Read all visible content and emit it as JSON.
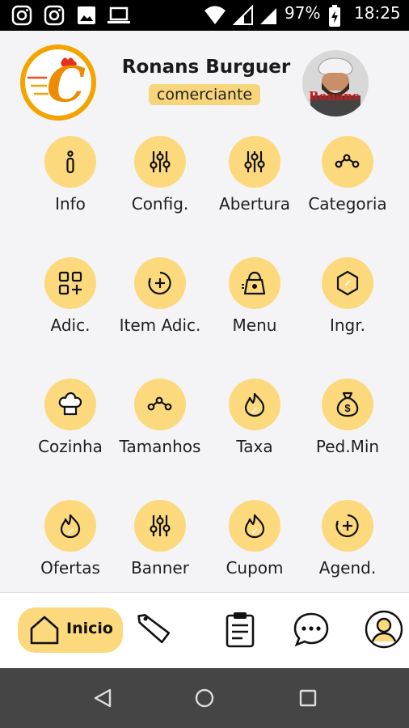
{
  "status_bar": {
    "battery": "97%",
    "time": "18:25"
  },
  "header": {
    "store_name": "Ronans Burguer",
    "role": "comerciante",
    "logo_letter": "C",
    "avatar_text": "Ronans"
  },
  "menu": [
    {
      "label": "Info",
      "icon": "info-icon"
    },
    {
      "label": "Config.",
      "icon": "sliders-icon"
    },
    {
      "label": "Abertura",
      "icon": "sliders-icon"
    },
    {
      "label": "Categoria",
      "icon": "nodes-icon"
    },
    {
      "label": "Adic.",
      "icon": "grid-plus-icon"
    },
    {
      "label": "Item Adic.",
      "icon": "circle-plus-icon"
    },
    {
      "label": "Menu",
      "icon": "bag-icon"
    },
    {
      "label": "Ingr.",
      "icon": "hexagon-icon"
    },
    {
      "label": "Cozinha",
      "icon": "chef-hat-icon"
    },
    {
      "label": "Tamanhos",
      "icon": "nodes-icon"
    },
    {
      "label": "Taxa",
      "icon": "flame-icon"
    },
    {
      "label": "Ped.Min",
      "icon": "money-bag-icon"
    },
    {
      "label": "Ofertas",
      "icon": "flame-icon"
    },
    {
      "label": "Banner",
      "icon": "sliders-icon"
    },
    {
      "label": "Cupom",
      "icon": "flame-icon"
    },
    {
      "label": "Agend.",
      "icon": "circle-plus-icon"
    }
  ],
  "bottom_nav": {
    "home_label": "Inicio",
    "items": [
      "home-icon",
      "tag-icon",
      "clipboard-icon",
      "chat-icon",
      "profile-icon"
    ]
  },
  "colors": {
    "accent": "#fcd97d",
    "badge": "#f7d57a",
    "logo_orange": "#f4a300",
    "system_bar": "#454545"
  }
}
